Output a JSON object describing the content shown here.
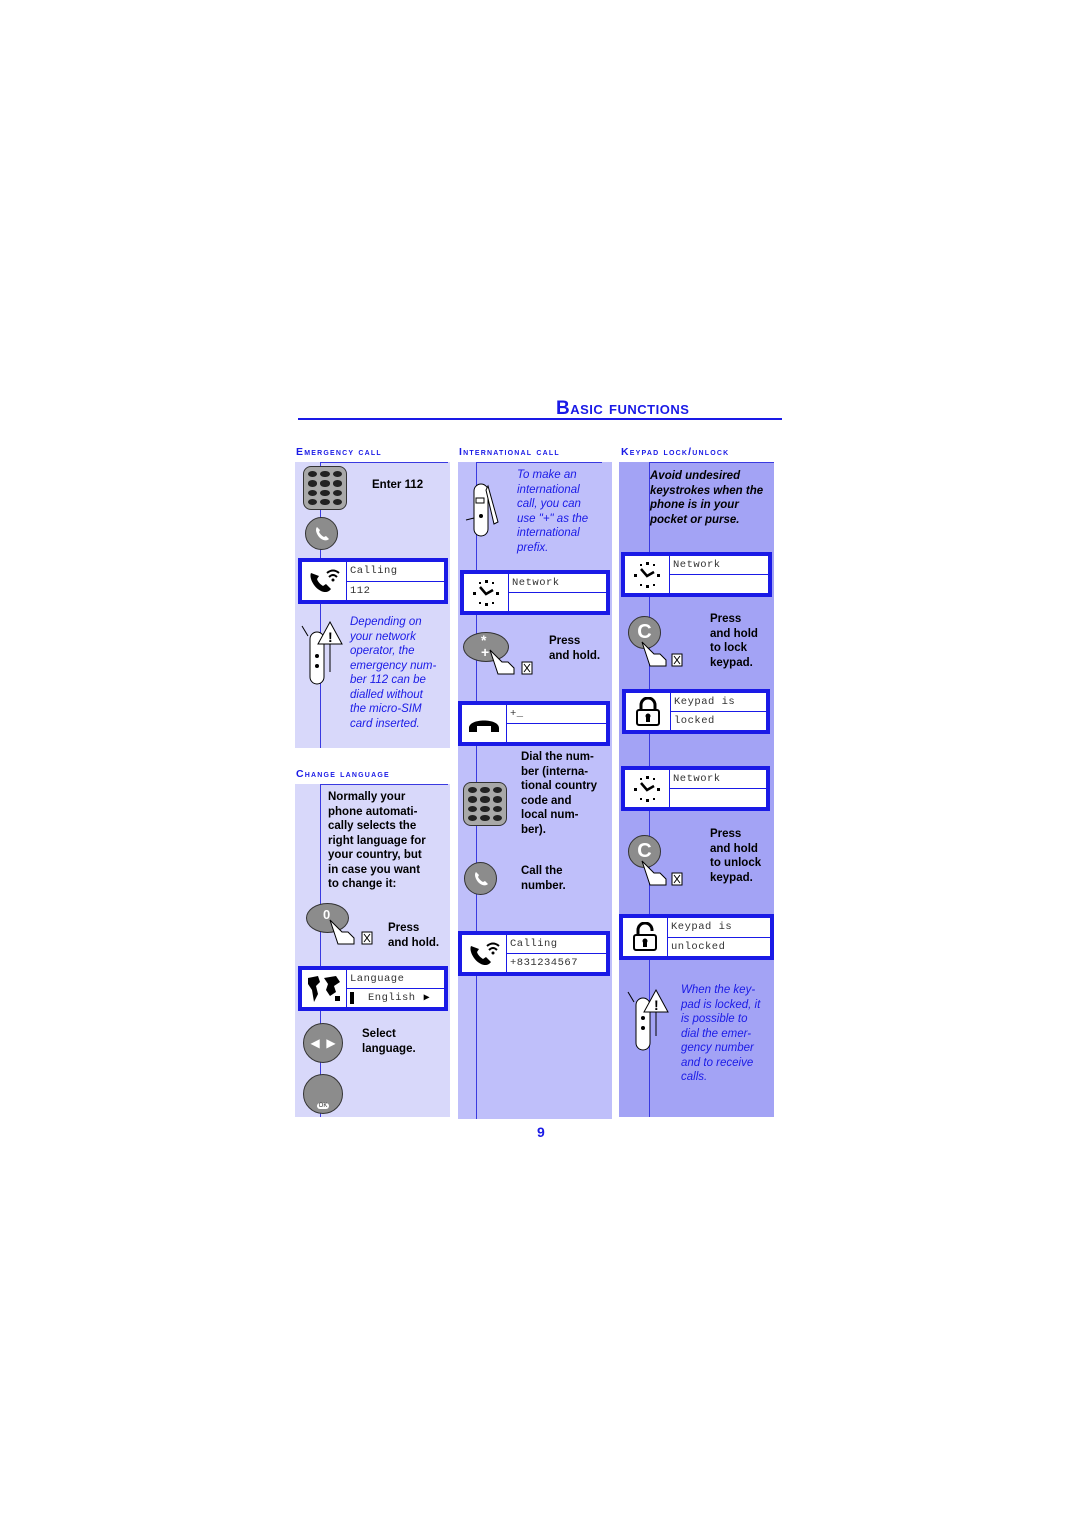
{
  "page": {
    "title": "Basic functions",
    "page_number": "9",
    "colors": {
      "accent": "#1a1ae6",
      "col1_bg": "#d8d8fa",
      "col2_bg": "#bfbffa",
      "col3_bg": "#a3a3f5"
    }
  },
  "emergency": {
    "heading": "Emergency call",
    "step1": "Enter 112",
    "screen1": {
      "icon": "calling-phone-icon",
      "line1": "Calling",
      "line2": "112"
    },
    "note": [
      "Depending on",
      "your network",
      "operator, the",
      "emergency num-",
      "ber 112 can  be",
      "dialled without",
      "the micro-SIM",
      "card inserted."
    ]
  },
  "language": {
    "heading": "Change language",
    "intro": [
      "Normally your",
      "phone automati-",
      "cally selects the",
      "right language for",
      "your country, but",
      "in case you want",
      "to change it:"
    ],
    "key_label": "0",
    "step1": [
      "Press",
      "and hold."
    ],
    "screen": {
      "icon": "world-map-icon",
      "line1": "Language",
      "line2": "English"
    },
    "step2": [
      "Select",
      "language."
    ],
    "ok_label": "OK"
  },
  "international": {
    "heading": "International call",
    "note": [
      "To make an",
      "international",
      "call, you can",
      "use \"+\" as the",
      "international",
      "prefix."
    ],
    "screen1": {
      "icon": "clock-icon",
      "line1": "Network",
      "line2": ""
    },
    "key_label_top": "*",
    "key_label_bottom": "+",
    "step1": [
      "Press",
      "and hold."
    ],
    "screen2": {
      "icon": "handset-icon",
      "line1": "+_",
      "line2": ""
    },
    "step2": [
      "Dial the num-",
      "ber (interna-",
      "tional country",
      "code and",
      "local num-",
      "ber)."
    ],
    "step3": [
      "Call the",
      "number."
    ],
    "screen3": {
      "icon": "calling-phone-icon",
      "line1": "Calling",
      "line2": "+831234567"
    }
  },
  "keypad": {
    "heading": "Keypad lock/unlock",
    "intro": [
      "Avoid undesired",
      "keystrokes when the",
      "phone is in your",
      "pocket or purse."
    ],
    "screen1": {
      "icon": "clock-icon",
      "line1": "Network",
      "line2": ""
    },
    "key_label": "C",
    "step1": [
      "Press",
      "and hold",
      "to lock",
      "keypad."
    ],
    "screen2": {
      "icon": "padlock-closed-icon",
      "line1": "Keypad is",
      "line2": "locked"
    },
    "screen3": {
      "icon": "clock-icon",
      "line1": "Network",
      "line2": ""
    },
    "step2": [
      "Press",
      "and hold",
      "to unlock",
      "keypad."
    ],
    "screen4": {
      "icon": "padlock-open-icon",
      "line1": "Keypad is",
      "line2": "unlocked"
    },
    "note": [
      "When the key-",
      "pad is locked, it",
      "is possible to",
      "dial the emer-",
      "gency number",
      "and to receive",
      "calls."
    ]
  }
}
